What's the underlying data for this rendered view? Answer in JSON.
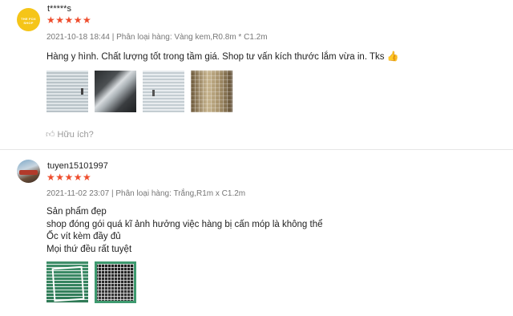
{
  "reviews": [
    {
      "author": "t*****s",
      "avatar_text": "THE FOX SHOP",
      "stars": "★★★★★",
      "meta": "2021-10-18 18:44 | Phân loại hàng: Vàng kem,R0.8m * C1.2m",
      "text": "Hàng y hình. Chất lượng tốt trong tầm giá. Shop tư vấn kích thước lắm vừa in. Tks",
      "emoji": "👍",
      "helpful": "Hữu ích?"
    },
    {
      "author": "tuyen15101997",
      "stars": "★★★★★",
      "meta": "2021-11-02 23:07 | Phân loại hàng: Trắng,R1m x C1.2m",
      "lines": [
        "Sản phẩm đẹp",
        "shop đóng gói quá kĩ ảnh hưởng việc hàng bị cấn móp là không thể",
        "Ốc vít kèm đầy đủ",
        "Mọi thứ đều rất tuyệt"
      ]
    }
  ],
  "colors": {
    "star": "#ee4d2d",
    "meta": "#777777",
    "divider": "#e6e6e6"
  },
  "icons": {
    "helpful": "thumbs-up-icon"
  }
}
